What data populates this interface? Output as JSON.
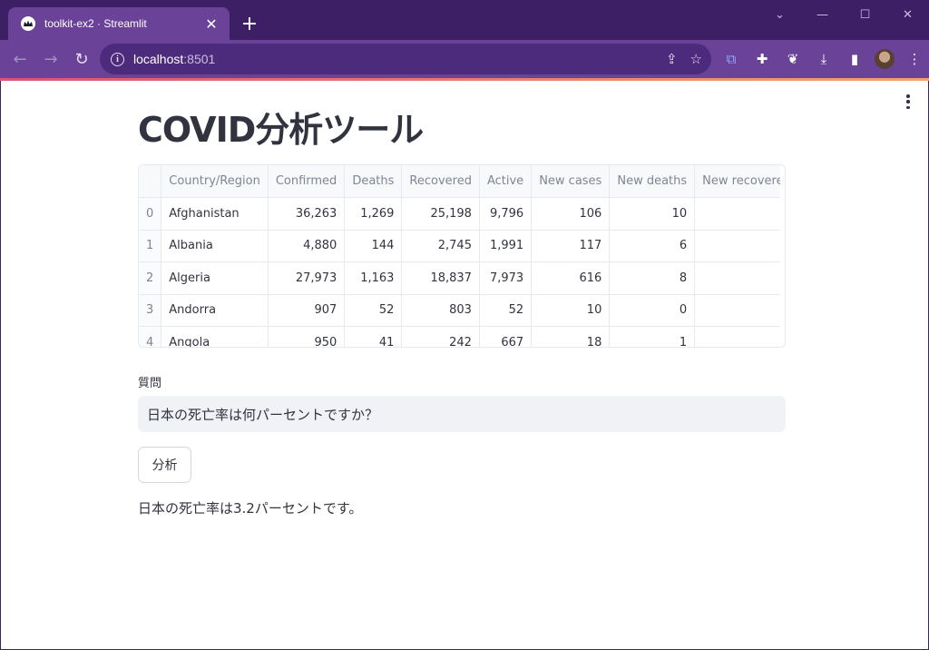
{
  "browser": {
    "tab_title": "toolkit-ex2 · Streamlit",
    "url_host": "localhost",
    "url_port": ":8501"
  },
  "app": {
    "title": "COVID分析ツール",
    "table": {
      "columns": [
        "",
        "Country/Region",
        "Confirmed",
        "Deaths",
        "Recovered",
        "Active",
        "New cases",
        "New deaths",
        "New recovered"
      ],
      "rows": [
        [
          "0",
          "Afghanistan",
          "36,263",
          "1,269",
          "25,198",
          "9,796",
          "106",
          "10",
          ""
        ],
        [
          "1",
          "Albania",
          "4,880",
          "144",
          "2,745",
          "1,991",
          "117",
          "6",
          ""
        ],
        [
          "2",
          "Algeria",
          "27,973",
          "1,163",
          "18,837",
          "7,973",
          "616",
          "8",
          ""
        ],
        [
          "3",
          "Andorra",
          "907",
          "52",
          "803",
          "52",
          "10",
          "0",
          ""
        ],
        [
          "4",
          "Angola",
          "950",
          "41",
          "242",
          "667",
          "18",
          "1",
          ""
        ]
      ]
    },
    "question_label": "質問",
    "question_value": "日本の死亡率は何パーセントですか？",
    "button_label": "分析",
    "answer": "日本の死亡率は3.2パーセントです。"
  }
}
